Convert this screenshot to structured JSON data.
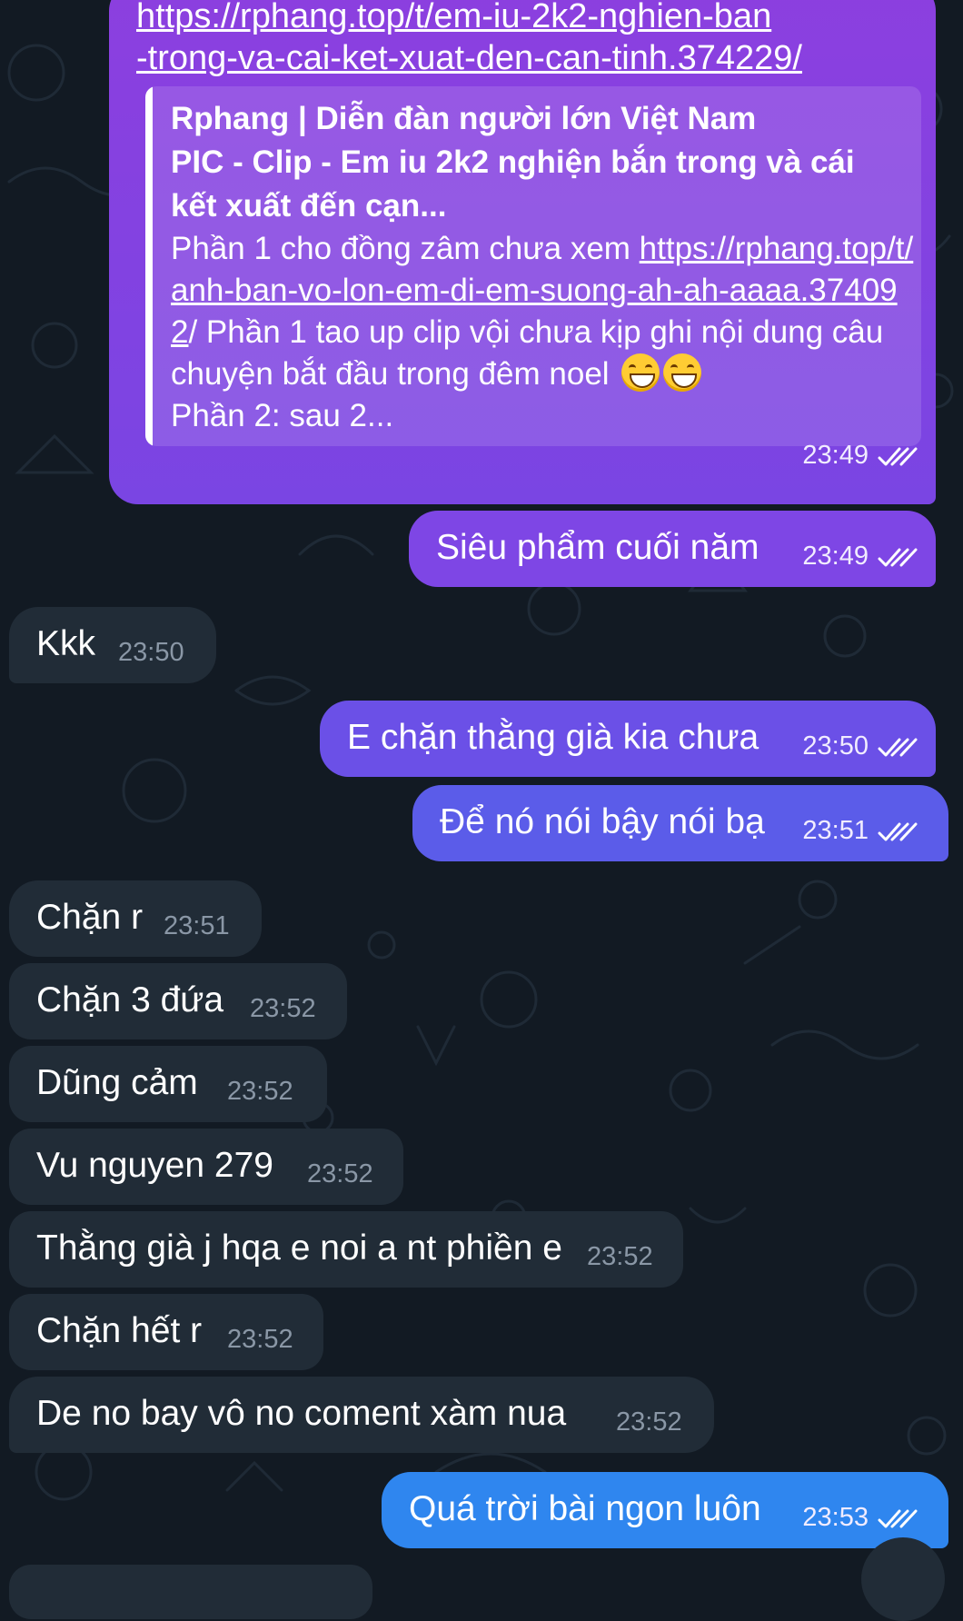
{
  "colors": {
    "background": "#121a23",
    "outgoing_top": "#8e3fe0",
    "outgoing_mid": "#6a55e6",
    "outgoing_bottom": "#2f86ef",
    "incoming": "#212c37",
    "incoming_time": "#8a97a6"
  },
  "link_message": {
    "url_text": "https://rphang.top/t/em-iu-2k2-nghien-ban\n-trong-va-cai-ket-xuat-den-can-tinh.374229/",
    "url_line1": "https://rphang.top/t/em-iu-2k2-nghien-ban",
    "url_line2": "-trong-va-cai-ket-xuat-den-can-tinh.374229/",
    "preview": {
      "site": "Rphang | Diễn đàn người lớn Việt Nam",
      "title": "PIC - Clip - Em iu 2k2 nghiện bắn trong và cái kết xuất đến cạn...",
      "desc_before_link": "Phần 1 cho đồng zâm chưa xem ",
      "desc_link": "https://rphang.top/t/anh-ban-vo-lon-em-di-em-suong-ah-ah-aaaa.374092",
      "desc_after_link": "/ Phần 1 tao up clip vội chưa kịp ghi nội dung câu chuyện bắt đầu trong đêm noel",
      "desc_emoji": [
        "grinning-face-emoji",
        "grinning-face-emoji"
      ],
      "desc_line_last": "Phần 2: sau 2..."
    },
    "time": "23:49",
    "status_icon": "double-check-icon"
  },
  "messages": [
    {
      "dir": "out",
      "text": "Siêu phẩm cuối năm",
      "time": "23:49"
    },
    {
      "dir": "in",
      "text": "Kkk",
      "time": "23:50"
    },
    {
      "dir": "out",
      "text": "E chặn thằng già kia chưa",
      "time": "23:50"
    },
    {
      "dir": "out",
      "text": "Để nó nói bậy nói bạ",
      "time": "23:51"
    },
    {
      "dir": "in",
      "text": "Chặn r",
      "time": "23:51"
    },
    {
      "dir": "in",
      "text": "Chặn 3 đứa",
      "time": "23:52"
    },
    {
      "dir": "in",
      "text": "Dũng cảm",
      "time": "23:52"
    },
    {
      "dir": "in",
      "text": "Vu nguyen 279",
      "time": "23:52"
    },
    {
      "dir": "in",
      "text": "Thằng già j hqa e noi a nt phiền e",
      "time": "23:52"
    },
    {
      "dir": "in",
      "text": "Chặn hết r",
      "time": "23:52"
    },
    {
      "dir": "in",
      "text": "De no bay vô no coment xàm nua",
      "time": "23:52"
    },
    {
      "dir": "out",
      "text": "Quá trời bài ngon luôn",
      "time": "23:53"
    }
  ]
}
